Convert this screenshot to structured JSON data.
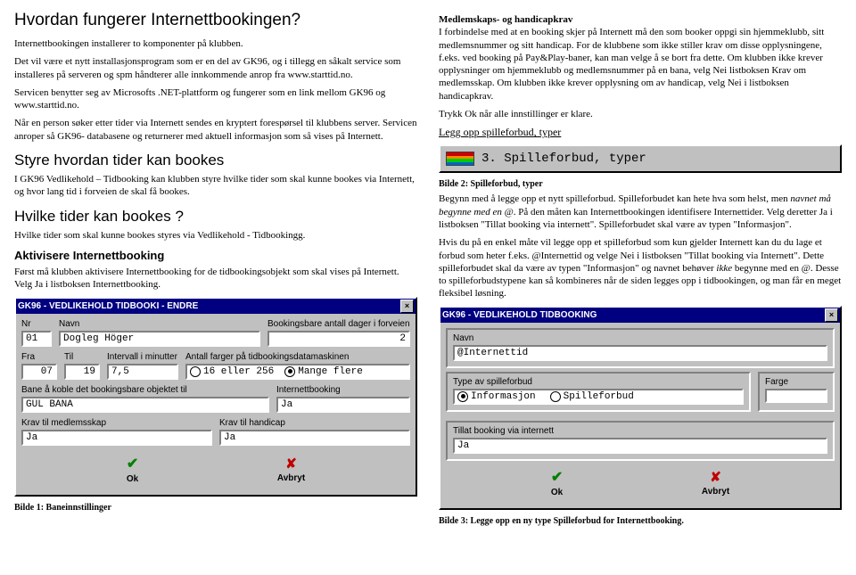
{
  "left": {
    "h1": "Hvordan fungerer Internettbookingen?",
    "p1": "Internettbookingen installerer to komponenter på klubben.",
    "p2": "Det vil være et nytt installasjonsprogram som er en del av GK96, og i tillegg en såkalt service som installeres på serveren og spm håndterer alle innkommende anrop fra www.starttid.no.",
    "p3": "Servicen benytter seg av Microsofts .NET-plattform og fungerer som en link mellom GK96 og www.starttid.no.",
    "p4": "Når en person søker etter tider via Internett sendes en kryptert forespørsel til klubbens server. Servicen anroper så GK96- databasene og returnerer med aktuell informasjon som så vises på Internett.",
    "h2a": "Styre hvordan tider kan bookes",
    "p5": "I GK96 Vedlikehold – Tidbooking kan klubben styre hvilke tider som skal kunne bookes via Internett, og hvor lang tid i forveien de skal få bookes.",
    "h2b": "Hvilke tider kan bookes ?",
    "p6": "Hvilke tider som skal kunne bookes styres via Vedlikehold - Tidbookingg.",
    "h3a": "Aktivisere Internettbooking",
    "p7": "Først må klubben aktivisere Internettbooking for de tidbookingsobjekt som skal vises på Internett. Velg Ja i listboksen Internettbooking.",
    "caption1": "Bilde 1: Baneinnstillinger"
  },
  "dlg1": {
    "title": "GK96 - VEDLIKEHOLD TIDBOOKI - ENDRE",
    "nr_label": "Nr",
    "nr": "01",
    "navn_label": "Navn",
    "navn": "Dogleg Höger",
    "book_label": "Bookingsbare antall dager i forveien",
    "book_val": "2",
    "fra_label": "Fra",
    "fra": "07",
    "til_label": "Til",
    "til": "19",
    "intv_label": "Intervall i minutter",
    "intv": "7,5",
    "farger_label": "Antall farger på tidbookingsdatamaskinen",
    "farger_opt1": "16 eller 256",
    "farger_opt2": "Mange flere",
    "bane_label": "Bane å koble det bookingsbare objektet til",
    "bane": "GUL BANA",
    "ibook_label": "Internettbooking",
    "ibook": "Ja",
    "krav_medl_label": "Krav til medlemsskap",
    "krav_medl": "Ja",
    "krav_hc_label": "Krav til handicap",
    "krav_hc": "Ja",
    "ok": "Ok",
    "avbryt": "Avbryt"
  },
  "right": {
    "h3m": "Medlemskaps- og handicapkrav",
    "p1": "I forbindelse med at en booking skjer på Internett må den som booker oppgi sin hjemmeklubb, sitt medlemsnummer og sitt handicap. For de klubbene som ikke stiller krav om disse opplysningene, f.eks. ved booking på Pay&Play-baner, kan man velge å se bort fra dette. Om klubben ikke krever opplysninger om hjemmeklubb og medlemsnummer på en bana, velg Nei listboksen Krav om medlemsskap. Om klubben ikke krever opplysning om av handicap, velg Nei i listboksen handicapkrav.",
    "p2": "Trykk Ok når alle innstillinger er klare.",
    "und1": "Legg opp spilleforbud, typer",
    "box2_text": "3. Spilleforbud, typer",
    "caption2": "Bilde 2: Spilleforbud, typer",
    "p3a": "Begynn med å legge opp et nytt spilleforbud. Spilleforbudet kan hete hva som helst, men ",
    "p3i": "navnet må begynne med en @",
    "p3b": ". På den måten kan Internettbookingen identifisere Internettider. Velg deretter Ja i listboksen \"Tillat booking via internett\". Spilleforbudet skal være av typen \"Informasjon\".",
    "p4a": "Hvis du på en enkel måte vil legge opp et spilleforbud som kun gjelder Internett kan du du lage et forbud som heter f.eks. @Internettid og velge Nei i listboksen \"Tillat booking via Internett\". Dette spilleforbudet skal da være av typen \"Informasjon\" og navnet behøver ",
    "p4i": "ikke",
    "p4b": " begynne med en @. Desse to spilleforbudstypene kan så kombineres når de siden legges opp i tidbookingen, og man får en meget fleksibel løsning.",
    "caption3": "Bilde 3:  Legge opp en ny type Spilleforbud for Internettbooking."
  },
  "dlg2": {
    "title": "GK96 - VEDLIKEHOLD TIDBOOKING",
    "navn_label": "Navn",
    "navn": "@Internettid",
    "type_label": "Type av spilleforbud",
    "opt1": "Informasjon",
    "opt2": "Spilleforbud",
    "farge_label": "Farge",
    "tillat_label": "Tillat booking via internett",
    "tillat": "Ja",
    "ok": "Ok",
    "avbryt": "Avbryt"
  }
}
